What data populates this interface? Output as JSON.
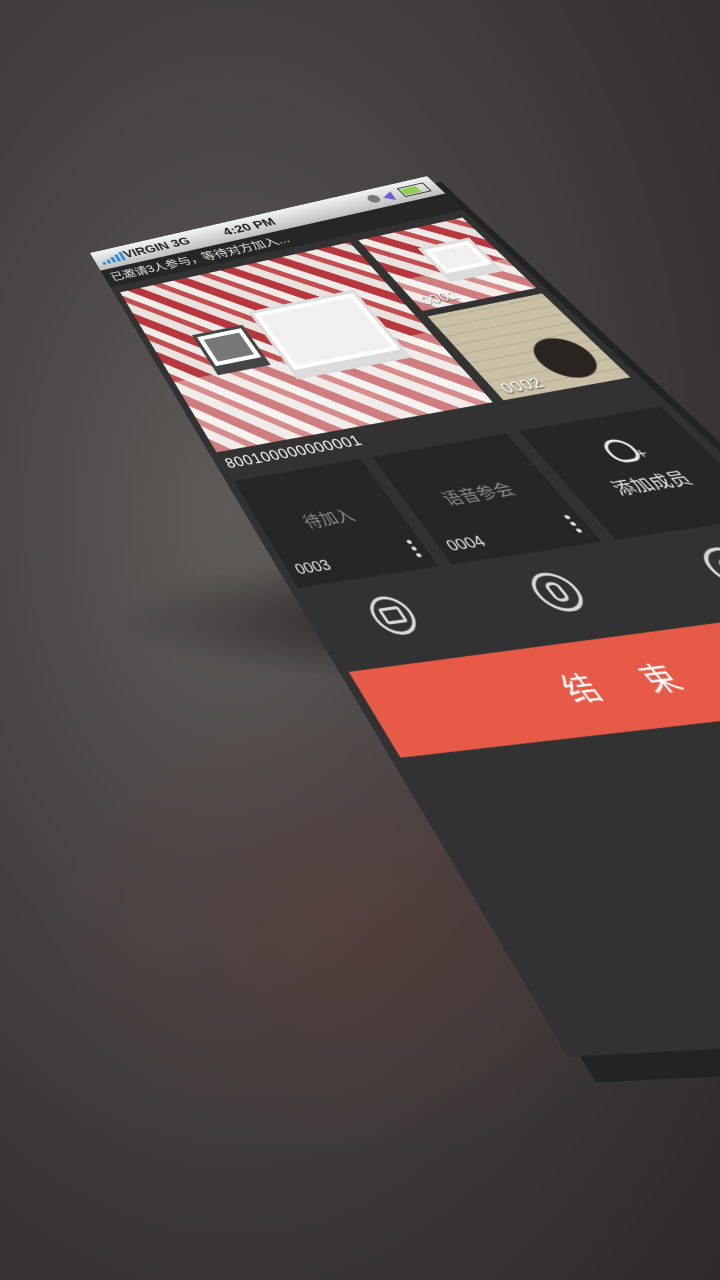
{
  "status_bar": {
    "carrier": "VIRGIN  3G",
    "time": "4:20 PM",
    "icons": [
      "signal-icon",
      "location-arrow-icon",
      "lock-rotation-icon",
      "battery-icon"
    ]
  },
  "notice": {
    "text": "已邀请3人参与，等待对方加入..."
  },
  "videos": {
    "main_id": "800100000000001",
    "thumb1_id": "0001",
    "thumb2_id": "0002"
  },
  "participants": [
    {
      "status": "待加入",
      "id": "0003"
    },
    {
      "status": "语音参会",
      "id": "0004"
    }
  ],
  "add_member": {
    "label": "添加成员"
  },
  "controls": {
    "icons": [
      "camera-switch-icon",
      "microphone-icon",
      "camera-icon"
    ]
  },
  "end_button": {
    "label": "结 束"
  },
  "colors": {
    "accent": "#e65a47",
    "panel": "#323232",
    "tile": "#262626"
  }
}
